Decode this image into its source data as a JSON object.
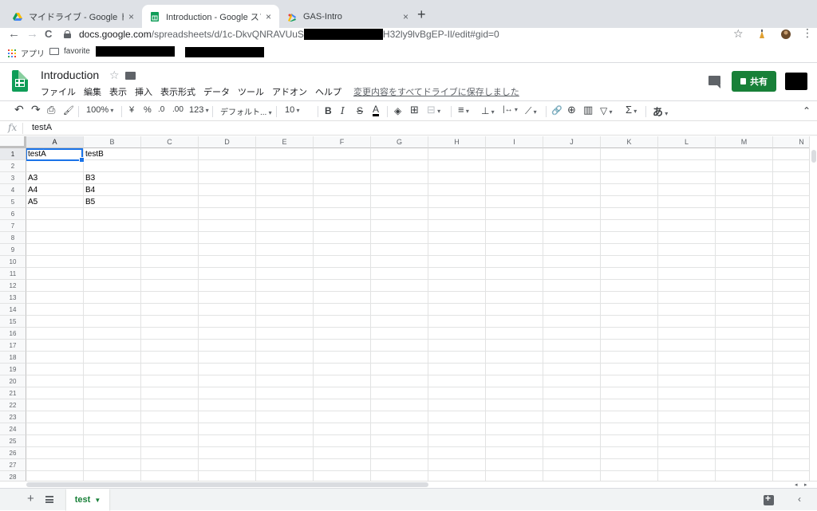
{
  "browser": {
    "tabs": [
      {
        "title": "マイドライブ - Google ドライブ",
        "close": "×"
      },
      {
        "title": "Introduction - Google スプレッ",
        "close": "×"
      },
      {
        "title": "GAS-Intro",
        "close": "×"
      }
    ],
    "new_tab": "+",
    "url_host": "docs.google.com",
    "url_path_start": "/spreadsheets/d/1c-DkvQNRAVUuS",
    "url_path_end": "H32ly9lvBgEP-Il/edit#gid=0",
    "nav_back": "←",
    "nav_forward": "→",
    "nav_reload": "C",
    "bookmark_star": "☆",
    "menu": "⋮",
    "bookmarks": [
      {
        "label": "アプリ"
      },
      {
        "label": "favorite"
      }
    ]
  },
  "sheets": {
    "title": "Introduction",
    "title_star": "☆",
    "menus": [
      "ファイル",
      "編集",
      "表示",
      "挿入",
      "表示形式",
      "データ",
      "ツール",
      "アドオン",
      "ヘルプ"
    ],
    "save_status": "変更内容をすべてドライブに保存しました",
    "share_label": "共有"
  },
  "toolbar": {
    "undo": "↶",
    "redo": "↷",
    "print": "⎙",
    "paint_format": "🖌",
    "zoom": "100%",
    "currency": "¥",
    "percent": "%",
    "dec_decrease": ".0",
    "dec_increase": ".00",
    "number_format": "123",
    "font": "デフォルト...",
    "font_size": "10",
    "bold": "B",
    "italic": "I",
    "strike": "S",
    "text_color": "A",
    "fill_color": "◈",
    "borders": "⊞",
    "merge": "⊟",
    "halign": "≡",
    "valign": "⊥",
    "wrap": "|↔",
    "rotate": "⟋",
    "link": "🔗",
    "comment": "⊕",
    "chart": "▥",
    "filter": "▽",
    "functions": "Σ",
    "input_tools": "あ",
    "collapse": "⌃"
  },
  "formula_bar": {
    "fx": "fx",
    "value": "testA"
  },
  "grid": {
    "columns": [
      "A",
      "B",
      "C",
      "D",
      "E",
      "F",
      "G",
      "H",
      "I",
      "J",
      "K",
      "L",
      "M",
      "N"
    ],
    "rows": [
      "1",
      "2",
      "3",
      "4",
      "5",
      "6",
      "7",
      "8",
      "9",
      "10",
      "11",
      "12",
      "13",
      "14",
      "15",
      "16",
      "17",
      "18",
      "19",
      "20",
      "21",
      "22",
      "23",
      "24",
      "25",
      "26",
      "27",
      "28"
    ],
    "cells": {
      "A1": "testA",
      "B1": "testB",
      "A3": "A3",
      "B3": "B3",
      "A4": "A4",
      "B4": "B4",
      "A5": "A5",
      "B5": "B5"
    },
    "selected_cell": "A1"
  },
  "sheet_tabs": {
    "add": "+",
    "active": "test"
  },
  "colors": {
    "sheets_green": "#0f9d58",
    "share_green": "#188038",
    "selection_blue": "#1a73e8"
  }
}
